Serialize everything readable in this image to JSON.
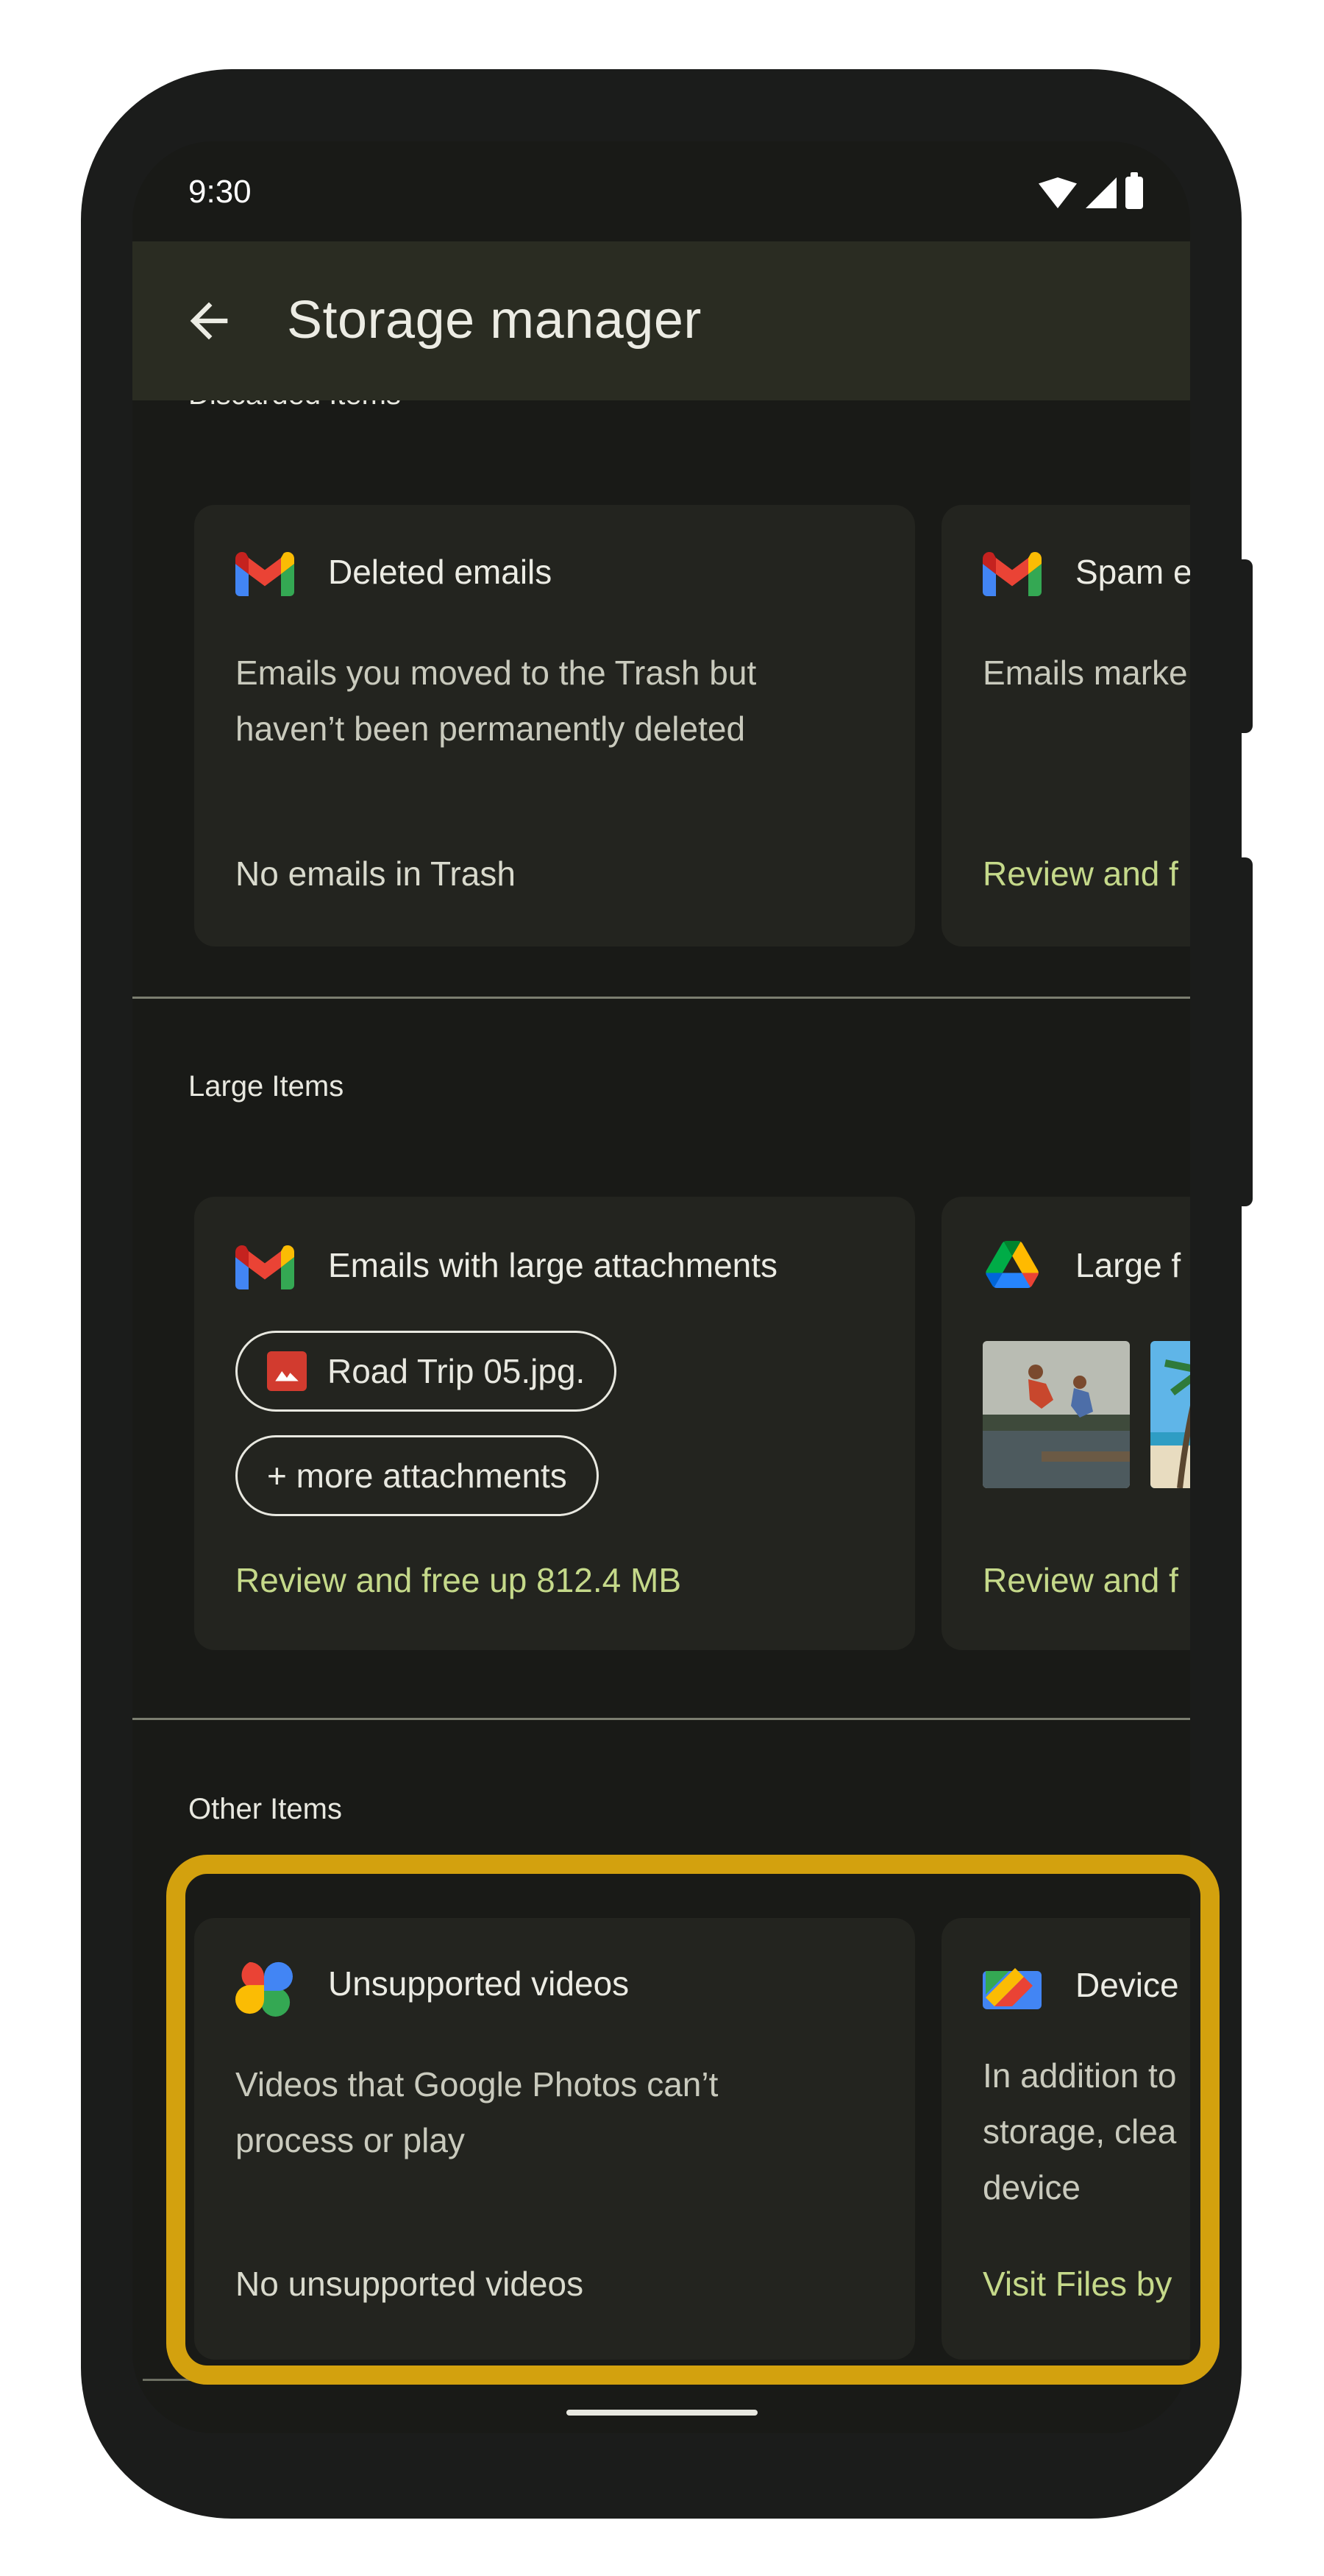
{
  "status_bar": {
    "time": "9:30"
  },
  "app_bar": {
    "title": "Storage manager"
  },
  "sections": {
    "discarded": {
      "label": "Discarded Items",
      "cards": [
        {
          "icon": "gmail-icon",
          "title": "Deleted emails",
          "description": "Emails you moved to the Trash but\nhaven’t been permanently deleted",
          "status": "No emails in Trash"
        },
        {
          "icon": "gmail-icon",
          "title": "Spam e",
          "description": "Emails marke",
          "action": "Review and f"
        }
      ]
    },
    "large": {
      "label": "Large Items",
      "cards": [
        {
          "icon": "gmail-icon",
          "title": "Emails with large attachments",
          "chips": [
            "Road Trip 05.jpg.",
            "+ more attachments"
          ],
          "action": "Review and free up 812.4 MB"
        },
        {
          "icon": "google-drive-icon",
          "title": "Large f",
          "action": "Review and f"
        }
      ]
    },
    "other": {
      "label": "Other Items",
      "cards": [
        {
          "icon": "google-photos-icon",
          "title": "Unsupported videos",
          "description": "Videos that Google Photos can’t\nprocess or play",
          "status": "No unsupported videos"
        },
        {
          "icon": "files-by-google-icon",
          "title": "Device",
          "description": "In addition to\nstorage, clea\ndevice",
          "action": "Visit Files by"
        }
      ]
    }
  },
  "colors": {
    "accent": "#c5d98a",
    "highlight": "#d3a10e",
    "card": "#23241f",
    "background": "#191a17"
  }
}
